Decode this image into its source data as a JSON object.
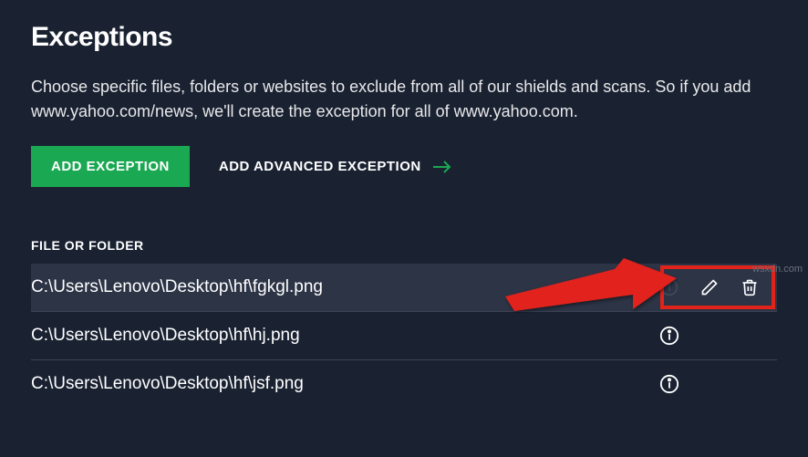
{
  "title": "Exceptions",
  "description": "Choose specific files, folders or websites to exclude from all of our shields and scans. So if you add www.yahoo.com/news, we'll create the exception for all of www.yahoo.com.",
  "buttons": {
    "add_exception": "ADD EXCEPTION",
    "add_advanced": "ADD ADVANCED EXCEPTION"
  },
  "section_label": "FILE OR FOLDER",
  "rows": [
    {
      "path": "C:\\Users\\Lenovo\\Desktop\\hf\\fgkgl.png",
      "selected": true
    },
    {
      "path": "C:\\Users\\Lenovo\\Desktop\\hf\\hj.png",
      "selected": false
    },
    {
      "path": "C:\\Users\\Lenovo\\Desktop\\hf\\jsf.png",
      "selected": false
    }
  ],
  "watermark": "wsxdn.com"
}
